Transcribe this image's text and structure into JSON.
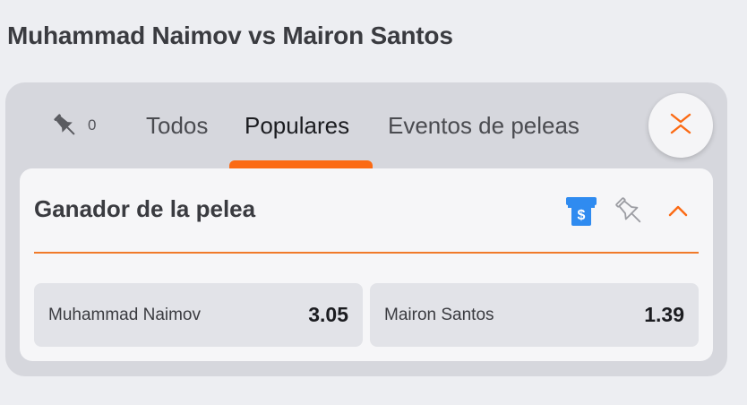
{
  "event": {
    "title": "Muhammad Naimov vs Mairon Santos"
  },
  "tabs": {
    "pinned_count": "0",
    "items": [
      {
        "label": "Todos",
        "active": false
      },
      {
        "label": "Populares",
        "active": true
      },
      {
        "label": "Eventos de peleas",
        "active": false
      }
    ]
  },
  "market": {
    "title": "Ganador de la pelea",
    "icons": [
      "cash-out-icon",
      "pin-icon",
      "chevron-up-icon"
    ],
    "selections": [
      {
        "name": "Muhammad Naimov",
        "odds": "3.05"
      },
      {
        "name": "Mairon Santos",
        "odds": "1.39"
      }
    ]
  },
  "colors": {
    "accent": "#fb6a14",
    "cashout": "#2f8bf0",
    "background": "#edeef2",
    "panel": "#d6d7dd"
  }
}
